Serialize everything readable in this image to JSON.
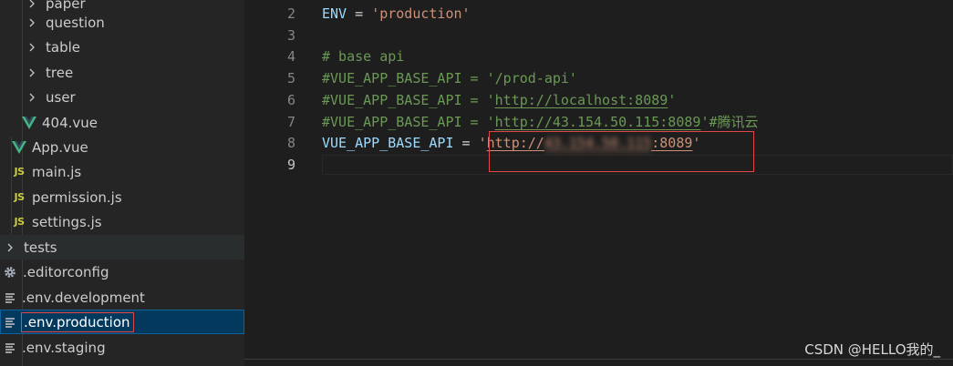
{
  "explorer": {
    "items": [
      {
        "label": "paper",
        "kind": "folder"
      },
      {
        "label": "question",
        "kind": "folder"
      },
      {
        "label": "table",
        "kind": "folder"
      },
      {
        "label": "tree",
        "kind": "folder"
      },
      {
        "label": "user",
        "kind": "folder"
      },
      {
        "label": "404.vue",
        "kind": "vue"
      },
      {
        "label": "App.vue",
        "kind": "vue"
      },
      {
        "label": "main.js",
        "kind": "js"
      },
      {
        "label": "permission.js",
        "kind": "js"
      },
      {
        "label": "settings.js",
        "kind": "js"
      },
      {
        "label": "tests",
        "kind": "folder"
      },
      {
        "label": ".editorconfig",
        "kind": "config"
      },
      {
        "label": ".env.development",
        "kind": "env"
      },
      {
        "label": ".env.production",
        "kind": "env",
        "selected": true
      },
      {
        "label": ".env.staging",
        "kind": "env"
      }
    ],
    "js_badge": "JS"
  },
  "editor": {
    "line_numbers": [
      "2",
      "3",
      "4",
      "5",
      "6",
      "7",
      "8",
      "9"
    ],
    "lines": {
      "l2_key": "ENV",
      "l2_eq": " = ",
      "l2_val": "'production'",
      "l4_comment": "# base api",
      "l5_comment": "#VUE_APP_BASE_API = '/prod-api'",
      "l6_prefix": "#VUE_APP_BASE_API = '",
      "l6_url": "http://localhost:8089",
      "l6_suffix": "'",
      "l7_prefix": "#VUE_APP_BASE_API = '",
      "l7_url": "http://43.154.50.115:8089",
      "l7_suffix": "'#腾讯云",
      "l8_key": "VUE_APP_BASE_API",
      "l8_eq": " = ",
      "l8_q1": "'",
      "l8_url_a": "http://",
      "l8_url_hidden": "43.154.50.115",
      "l8_url_b": ":8089",
      "l8_q2": "'"
    }
  },
  "watermark": "CSDN @HELLO我的_",
  "colors": {
    "background": "#1e1e1e",
    "sidebar": "#252526",
    "selection": "#04395e",
    "highlight_box": "#e04848",
    "string": "#ce9178",
    "comment": "#6a9955",
    "variable": "#9cdcfe"
  }
}
